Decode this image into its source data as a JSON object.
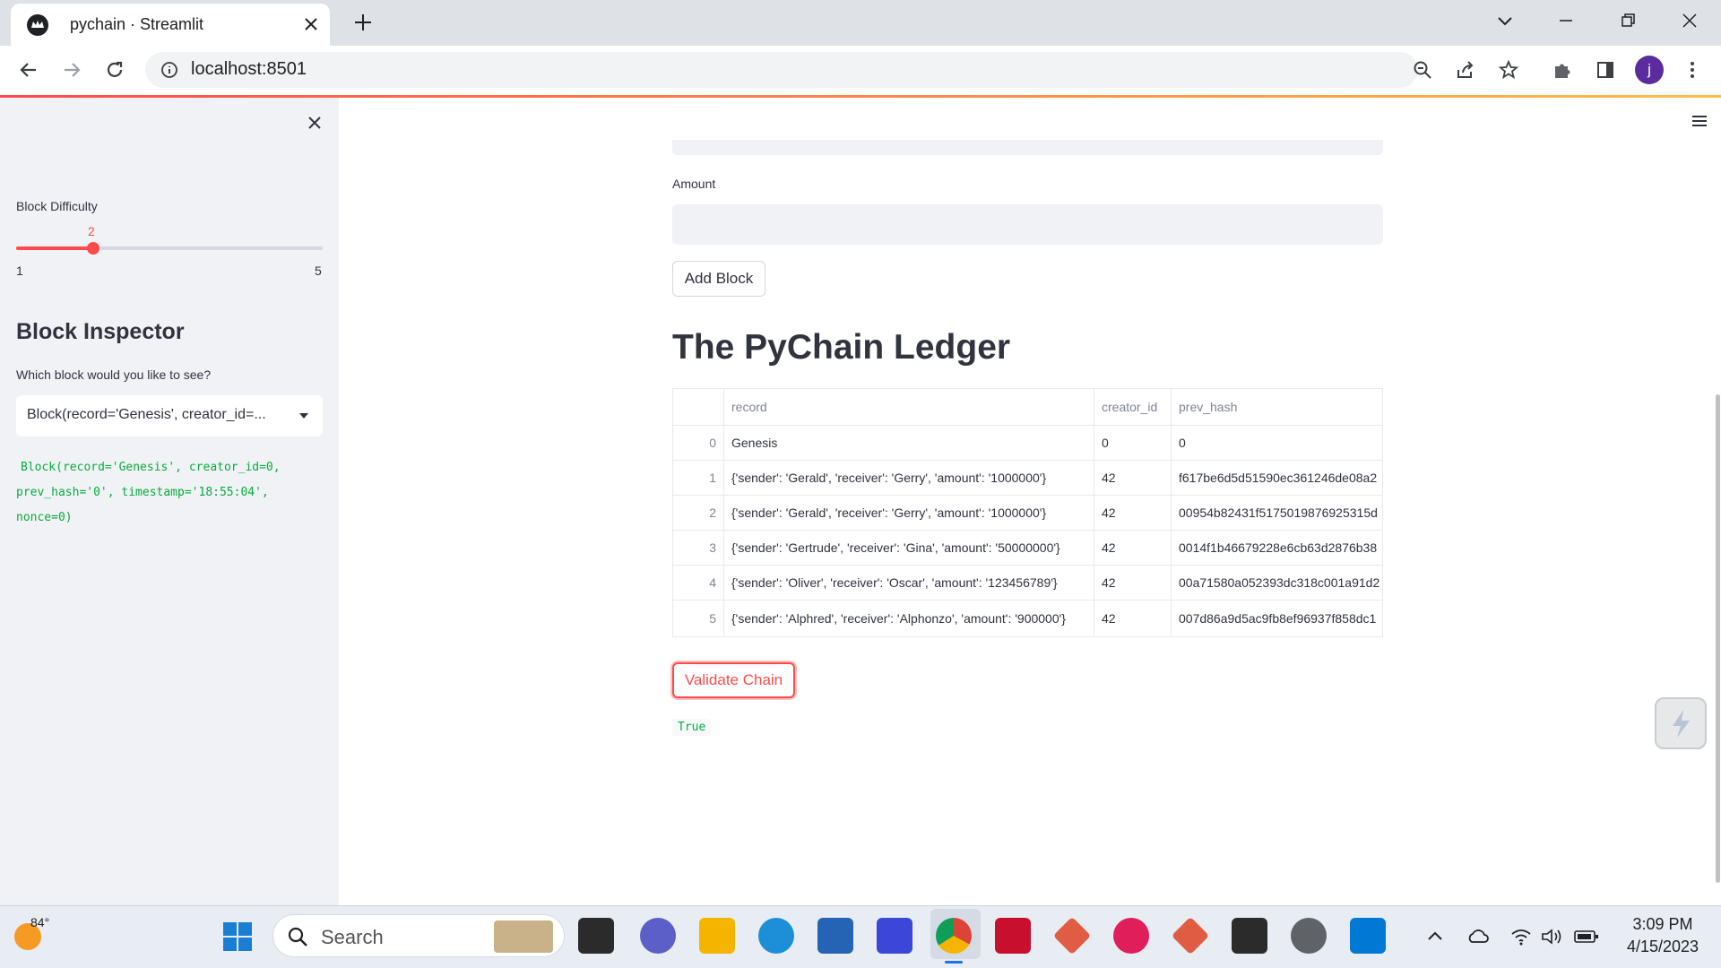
{
  "browser": {
    "tab_title": "pychain · Streamlit",
    "url": "localhost:8501"
  },
  "sidebar": {
    "slider": {
      "label": "Block Difficulty",
      "value": "2",
      "min": "1",
      "max": "5"
    },
    "inspector_title": "Block Inspector",
    "select_label": "Which block would you like to see?",
    "select_value": "Block(record='Genesis', creator_id=...",
    "code_line1": "Block(record='Genesis', creator_id=0,",
    "code_line2": "prev_hash='0', timestamp='18:55:04',",
    "code_line3": "nonce=0)"
  },
  "main": {
    "amount_label": "Amount",
    "add_block_label": "Add Block",
    "ledger_title": "The PyChain Ledger",
    "table": {
      "headers": [
        "",
        "record",
        "creator_id",
        "prev_hash"
      ],
      "rows": [
        [
          "0",
          "Genesis",
          "0",
          "0"
        ],
        [
          "1",
          "{'sender': 'Gerald', 'receiver': 'Gerry', 'amount': '1000000'}",
          "42",
          "f617be6d5d51590ec361246de08a2"
        ],
        [
          "2",
          "{'sender': 'Gerald', 'receiver': 'Gerry', 'amount': '1000000'}",
          "42",
          "00954b82431f5175019876925315d"
        ],
        [
          "3",
          "{'sender': 'Gertrude', 'receiver': 'Gina', 'amount': '50000000'}",
          "42",
          "0014f1b46679228e6cb63d2876b38"
        ],
        [
          "4",
          "{'sender': 'Oliver', 'receiver': 'Oscar', 'amount': '123456789'}",
          "42",
          "00a71580a052393dc318c001a91d2"
        ],
        [
          "5",
          "{'sender': 'Alphred', 'receiver': 'Alphonzo', 'amount': '900000'}",
          "42",
          "007d86a9d5ac9fb8ef96937f858dc1"
        ]
      ]
    },
    "validate_label": "Validate Chain",
    "validate_result": "True"
  },
  "taskbar": {
    "weather_temp": "84°",
    "search_label": "Search",
    "time": "3:09 PM",
    "date": "4/15/2023"
  },
  "colors": {
    "accent": "#ff4b4b",
    "code_green": "#09ab3b",
    "sidebar_bg": "#f0f2f6"
  }
}
